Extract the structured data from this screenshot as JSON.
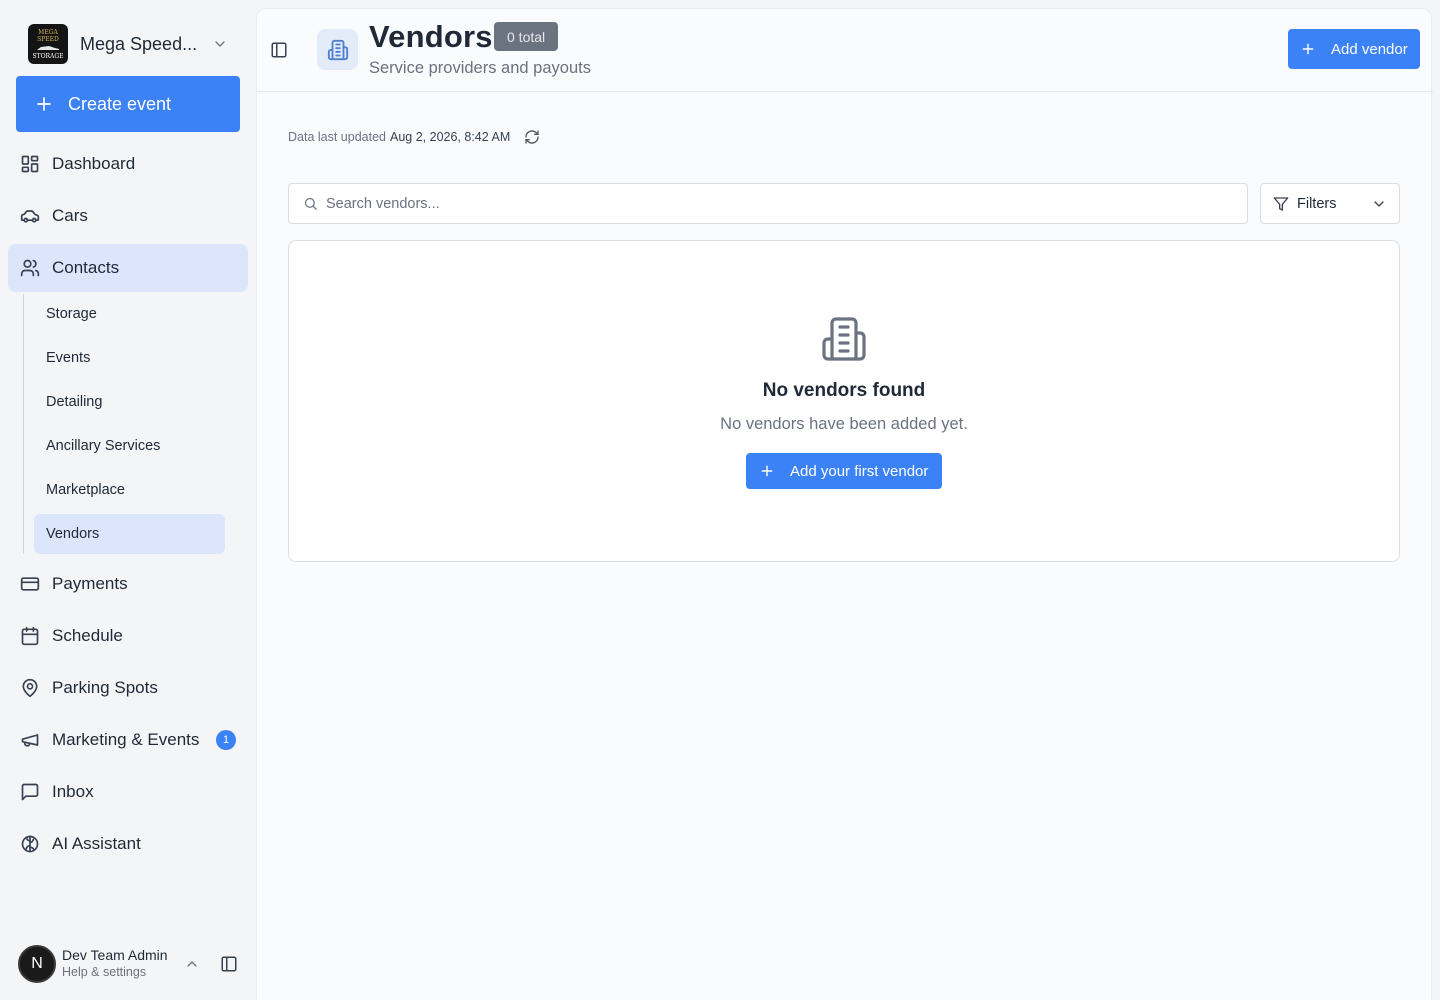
{
  "sidebar": {
    "brand": {
      "name": "Mega Speed...",
      "logo_text_top": "MEGA SPEED",
      "logo_text_bottom": "STORAGE"
    },
    "create_event_label": "Create event",
    "items": [
      {
        "label": "Dashboard",
        "icon": "dashboard-icon"
      },
      {
        "label": "Cars",
        "icon": "car-icon"
      },
      {
        "label": "Contacts",
        "icon": "users-icon",
        "active": true
      },
      {
        "label": "Payments",
        "icon": "credit-card-icon"
      },
      {
        "label": "Schedule",
        "icon": "calendar-icon"
      },
      {
        "label": "Parking Spots",
        "icon": "map-pin-icon"
      },
      {
        "label": "Marketing & Events",
        "icon": "megaphone-icon",
        "badge": "1"
      },
      {
        "label": "Inbox",
        "icon": "message-square-icon"
      },
      {
        "label": "AI Assistant",
        "icon": "brain-icon"
      }
    ],
    "sub_items": [
      {
        "label": "Storage"
      },
      {
        "label": "Events"
      },
      {
        "label": "Detailing"
      },
      {
        "label": "Ancillary Services"
      },
      {
        "label": "Marketplace"
      },
      {
        "label": "Vendors",
        "active": true
      }
    ],
    "user": {
      "initial": "N",
      "name": "Dev Team Admin",
      "subtitle": "Help & settings"
    }
  },
  "header": {
    "title": "Vendors",
    "count_badge": "0 total",
    "subtitle": "Service providers and payouts",
    "add_button_label": "Add vendor"
  },
  "status": {
    "updated_label": "Data last updated",
    "updated_value": "Aug 2, 2026, 8:42 AM"
  },
  "search": {
    "placeholder": "Search vendors...",
    "value": ""
  },
  "filters": {
    "label": "Filters"
  },
  "empty_state": {
    "title": "No vendors found",
    "message": "No vendors have been added yet.",
    "button_label": "Add your first vendor"
  },
  "colors": {
    "accent": "#3b82f6",
    "active_nav_bg": "#dbe6fd",
    "badge_gray": "#6b7280"
  }
}
